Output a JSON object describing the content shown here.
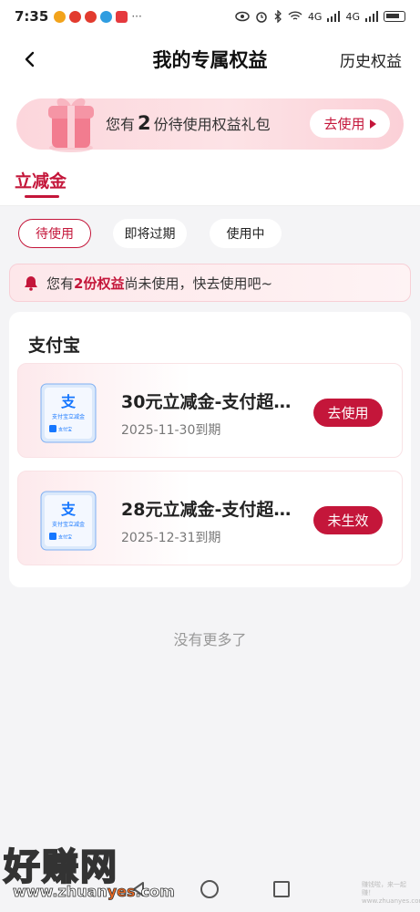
{
  "status_bar": {
    "time": "7:35",
    "network_labels": [
      "4G",
      "4G"
    ],
    "notif_colors": [
      "#f2a31b",
      "#e23b2e",
      "#e23b2e",
      "#2f9de0",
      "#e5393e"
    ]
  },
  "nav": {
    "title": "我的专属权益",
    "history": "历史权益"
  },
  "banner": {
    "prefix": "您有",
    "count": "2",
    "suffix": "份待使用权益礼包",
    "button": "去使用"
  },
  "tabs": {
    "active": "立减金"
  },
  "filters": [
    {
      "label": "待使用",
      "active": true
    },
    {
      "label": "即将过期",
      "active": false
    },
    {
      "label": "使用中",
      "active": false
    }
  ],
  "notice": {
    "prefix": "您有",
    "highlight": "2份权益",
    "suffix": "尚未使用，快去使用吧~"
  },
  "section": {
    "title": "支付宝"
  },
  "coupons": [
    {
      "name": "30元立减金-支付超…",
      "date": "2025-11-30到期",
      "button": "去使用",
      "img_title": "支付宝立减金",
      "img_brand": "支付宝"
    },
    {
      "name": "28元立减金-支付超…",
      "date": "2025-12-31到期",
      "button": "未生效",
      "img_title": "支付宝立减金",
      "img_brand": "支付宝"
    }
  ],
  "footer": {
    "no_more": "没有更多了"
  },
  "watermark": {
    "big": "好赚网",
    "small_a": "www.zhuan",
    "small_b": "yes",
    "small_c": ".com",
    "corner": "赚钱啦，来一起赚！www.zhuanyes.com"
  },
  "colors": {
    "accent": "#c4163a",
    "page_bg": "#f4f4f6",
    "alipay_blue": "#1677ff"
  }
}
